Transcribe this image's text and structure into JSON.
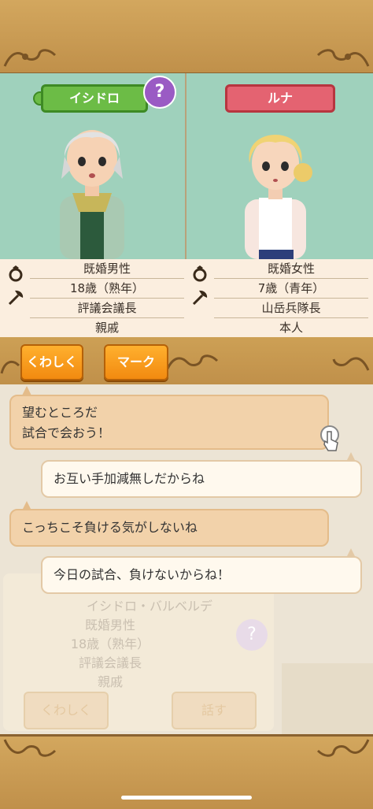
{
  "left_char": {
    "name": "イシドロ",
    "info": [
      "既婚男性",
      "18歳（熟年）",
      "評議会議長",
      "親戚"
    ]
  },
  "right_char": {
    "name": "ルナ",
    "info": [
      "既婚女性",
      "7歳（青年）",
      "山岳兵隊長",
      "本人"
    ]
  },
  "help_label": "?",
  "buttons": {
    "details": "くわしく",
    "mark": "マーク"
  },
  "chat": [
    {
      "speaker": "left",
      "text": [
        "望むところだ",
        "試合で会おう！"
      ]
    },
    {
      "speaker": "right",
      "text": [
        "お互い手加減無しだからね"
      ]
    },
    {
      "speaker": "left",
      "text": [
        "こっちこそ負ける気がしないね"
      ]
    },
    {
      "speaker": "right",
      "text": [
        "今日の試合、負けないからね！"
      ]
    }
  ],
  "background_panel": {
    "name": "イシドロ・バルベルデ",
    "info": [
      "既婚男性",
      "18歳（熟年）",
      "評議会議長",
      "親戚"
    ],
    "details_label": "くわしく",
    "talk_label": "話す",
    "help_label": "?"
  },
  "colors": {
    "green_tag": "#6cbc46",
    "red_tag": "#e46371",
    "orange_button": "#f28a10",
    "portrait_bg": "#9fd1bc"
  },
  "icons": [
    "ring-icon",
    "axe-icon",
    "tap-hand-icon"
  ]
}
